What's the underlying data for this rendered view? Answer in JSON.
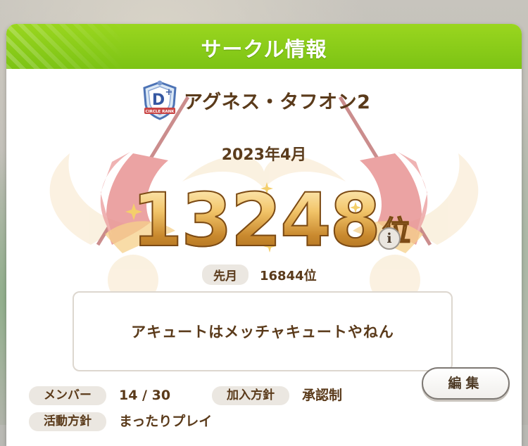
{
  "header": {
    "title": "サークル情報"
  },
  "circle": {
    "rank_badge_letter": "D+",
    "rank_badge_caption": "CIRCLE RANK",
    "name": "アグネス・タフオン2"
  },
  "ranking": {
    "month": "2023年4月",
    "rank": "13248",
    "rank_unit": "位",
    "info_icon": "i",
    "prev_label": "先月",
    "prev_value": "16844位"
  },
  "comment": "アキュートはメッチャキュートやねん",
  "fields": {
    "member_label": "メンバー",
    "member_value": "14 / 30",
    "join_policy_label": "加入方針",
    "join_policy_value": "承認制",
    "activity_label": "活動方針",
    "activity_value": "まったりプレイ"
  },
  "buttons": {
    "edit": "編集"
  },
  "colors": {
    "header_green": "#8ccd19",
    "text_brown": "#5a3a1a",
    "rank_gold": "#d8a247",
    "flag_red": "#e88a8a"
  }
}
